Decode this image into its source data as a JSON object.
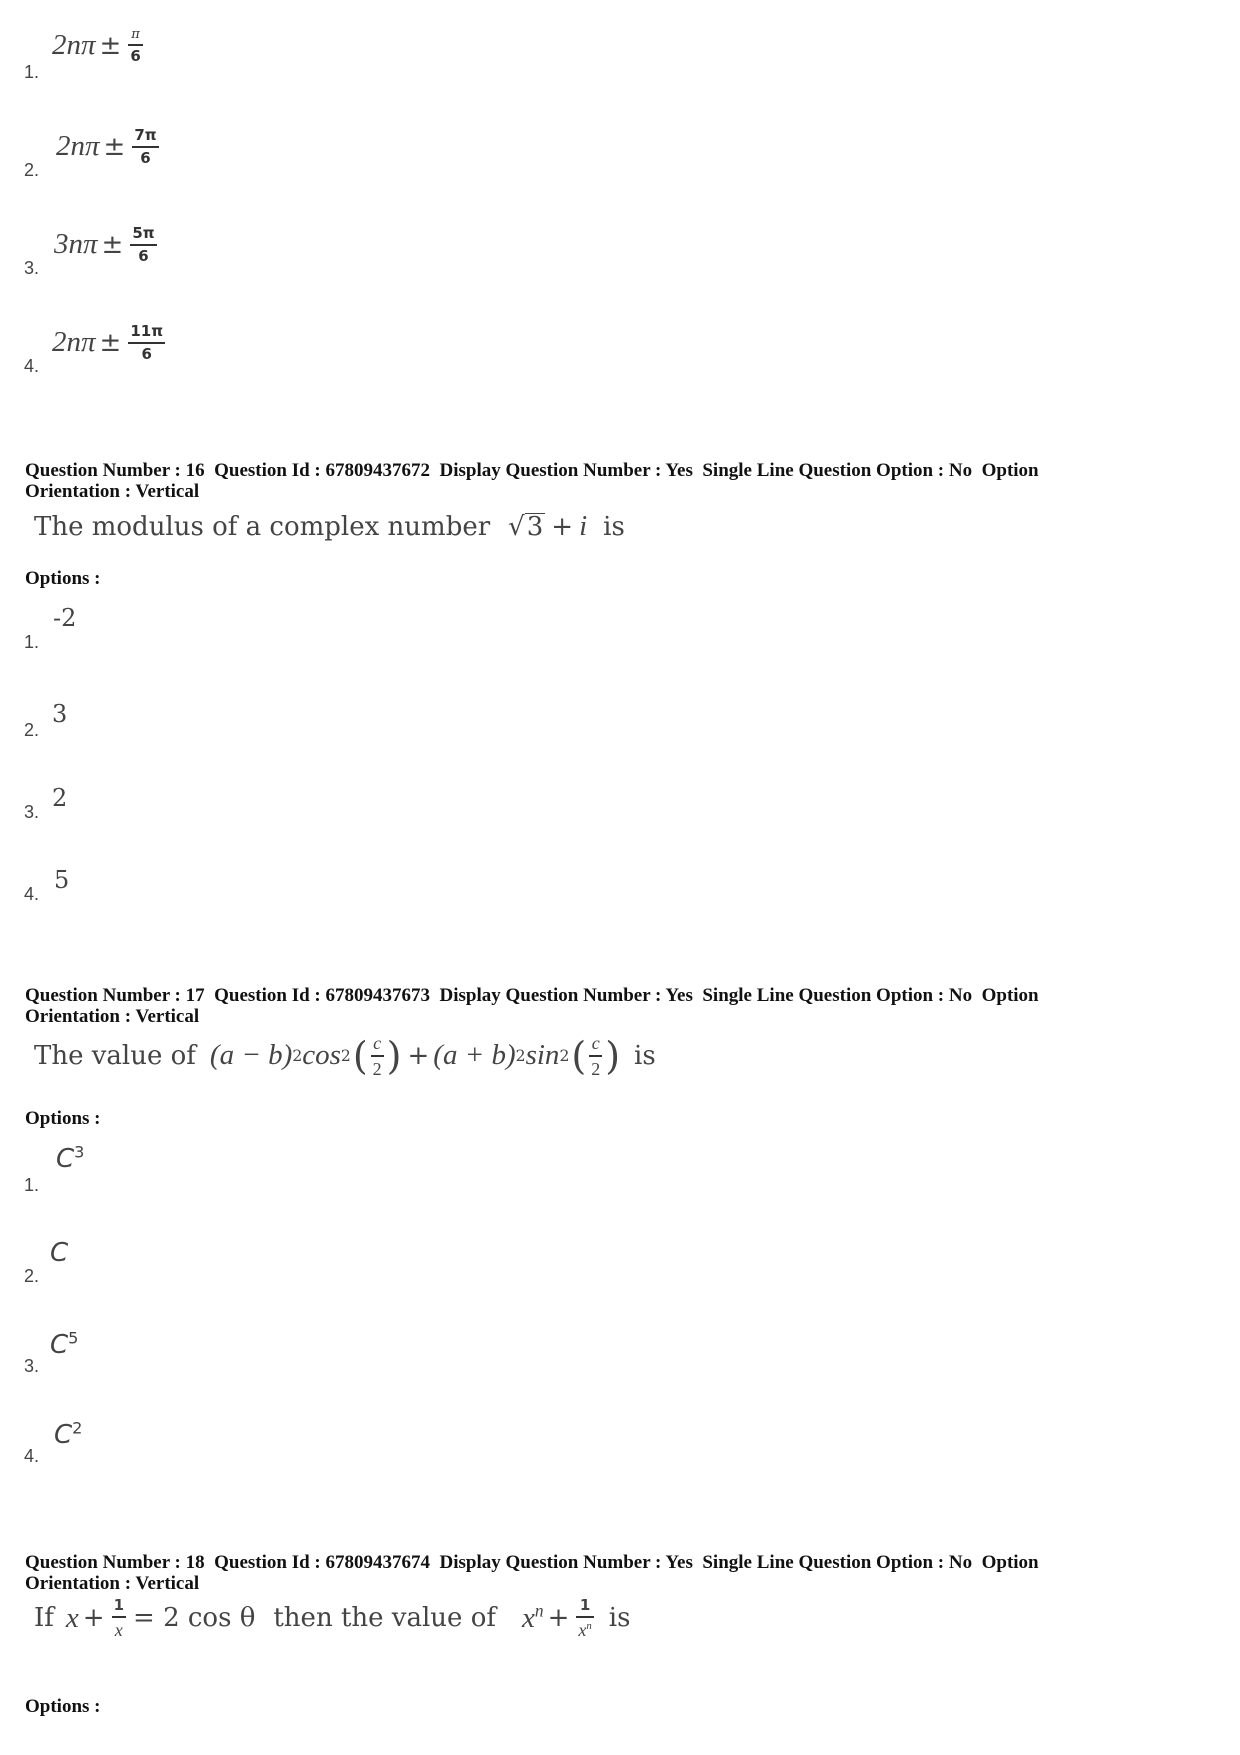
{
  "previous_question": {
    "options": [
      {
        "number": "1.",
        "coef": "2nπ",
        "op": "±",
        "numerator": "π",
        "denominator": "6"
      },
      {
        "number": "2.",
        "coef": "2nπ",
        "op": "±",
        "numerator": "7π",
        "denominator": "6"
      },
      {
        "number": "3.",
        "coef": "3nπ",
        "op": "±",
        "numerator": "5π",
        "denominator": "6"
      },
      {
        "number": "4.",
        "coef": "2nπ",
        "op": "±",
        "numerator": "11π",
        "denominator": "6"
      }
    ]
  },
  "questions": [
    {
      "header_line1": "Question Number : 16  Question Id : 67809437672  Display Question Number : Yes  Single Line Question Option : No  Option",
      "header_line2": "Orientation : Vertical",
      "text_prefix": "The modulus of a complex number",
      "sqrt_radicand": "3",
      "text_plus": "+",
      "text_var": "i",
      "text_suffix": "is",
      "options_label": "Options :",
      "options": [
        {
          "number": "1.",
          "value": "-2"
        },
        {
          "number": "2.",
          "value": "3"
        },
        {
          "number": "3.",
          "value": "2"
        },
        {
          "number": "4.",
          "value": "5"
        }
      ]
    },
    {
      "header_line1": "Question Number : 17  Question Id : 67809437673  Display Question Number : Yes  Single Line Question Option : No  Option",
      "header_line2": "Orientation : Vertical",
      "text_prefix": "The value of",
      "term1": "(a − b)",
      "term1_exp": "2",
      "func1": "cos",
      "func1_exp": "2",
      "plus": "+",
      "term2": "(a + b)",
      "term2_exp": "2",
      "func2": "sin",
      "func2_exp": "2",
      "frac_num": "c",
      "frac_den": "2",
      "text_suffix": "is",
      "options_label": "Options :",
      "options": [
        {
          "number": "1.",
          "base": "C",
          "exp": "3"
        },
        {
          "number": "2.",
          "base": "C",
          "exp": ""
        },
        {
          "number": "3.",
          "base": "C",
          "exp": "5"
        },
        {
          "number": "4.",
          "base": "C",
          "exp": "2"
        }
      ]
    },
    {
      "header_line1": "Question Number : 18  Question Id : 67809437674  Display Question Number : Yes  Single Line Question Option : No  Option",
      "header_line2": "Orientation : Vertical",
      "text_if": "If",
      "var_x": "x",
      "plus": "+",
      "frac1_num": "1",
      "frac1_den": "x",
      "equals_rhs": "= 2 cos θ",
      "text_middle": "then the value of",
      "var_xn_base": "x",
      "var_xn_exp": "n",
      "frac2_num": "1",
      "frac2_den_base": "x",
      "frac2_den_exp": "n",
      "text_suffix": "is",
      "options_label": "Options :"
    }
  ]
}
